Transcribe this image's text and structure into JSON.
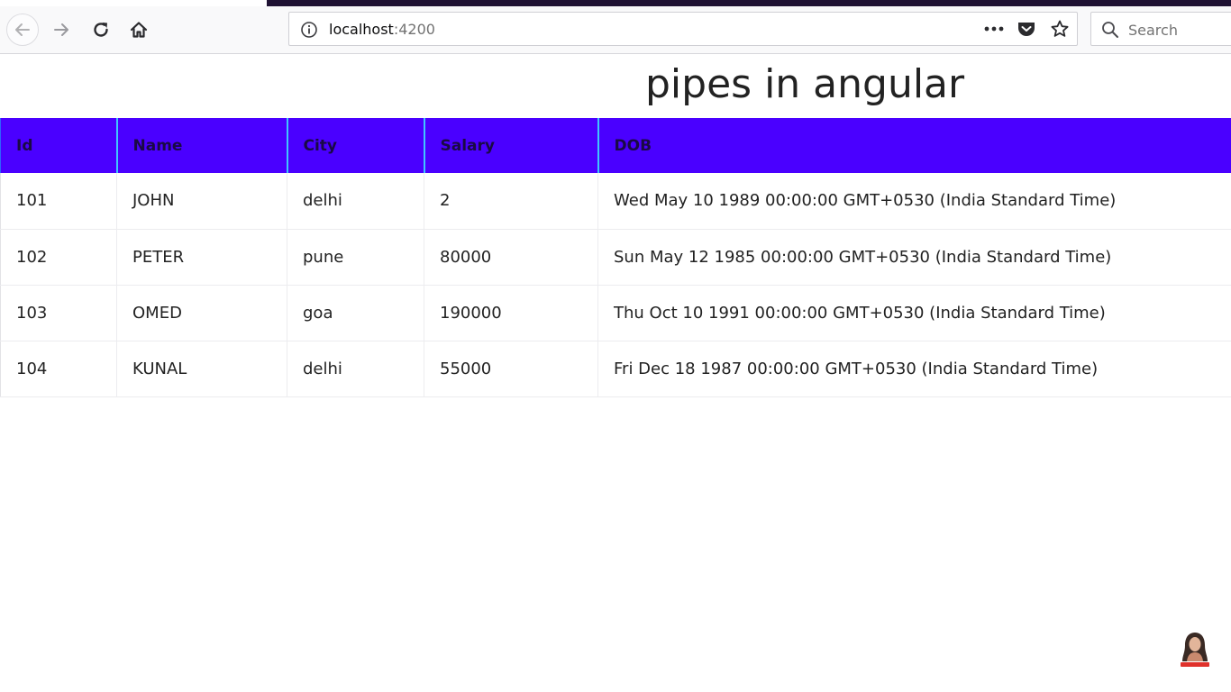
{
  "browser": {
    "url_host": "localhost",
    "url_port": ":4200",
    "search_placeholder": "Search"
  },
  "page": {
    "title": "pipes in angular"
  },
  "table": {
    "columns": [
      "Id",
      "Name",
      "City",
      "Salary",
      "DOB"
    ],
    "rows": [
      [
        "101",
        "JOHN",
        "delhi",
        "2",
        "Wed May 10 1989 00:00:00 GMT+0530 (India Standard Time)"
      ],
      [
        "102",
        "PETER",
        "pune",
        "80000",
        "Sun May 12 1985 00:00:00 GMT+0530 (India Standard Time)"
      ],
      [
        "103",
        "OMED",
        "goa",
        "190000",
        "Thu Oct 10 1991 00:00:00 GMT+0530 (India Standard Time)"
      ],
      [
        "104",
        "KUNAL",
        "delhi",
        "55000",
        "Fri Dec 18 1987 00:00:00 GMT+0530 (India Standard Time)"
      ]
    ]
  },
  "colors": {
    "header_bg": "#4a00ff",
    "header_text": "#1a0a44",
    "header_divider": "#3fc6ff"
  },
  "icons": {
    "back": "back-arrow-icon",
    "forward": "forward-arrow-icon",
    "reload": "reload-icon",
    "home": "home-icon",
    "info": "info-icon",
    "page_actions": "more-dots-icon",
    "pocket": "pocket-icon",
    "bookmark": "star-icon",
    "search": "search-icon",
    "subscribe": "subscribe-avatar-icon"
  }
}
